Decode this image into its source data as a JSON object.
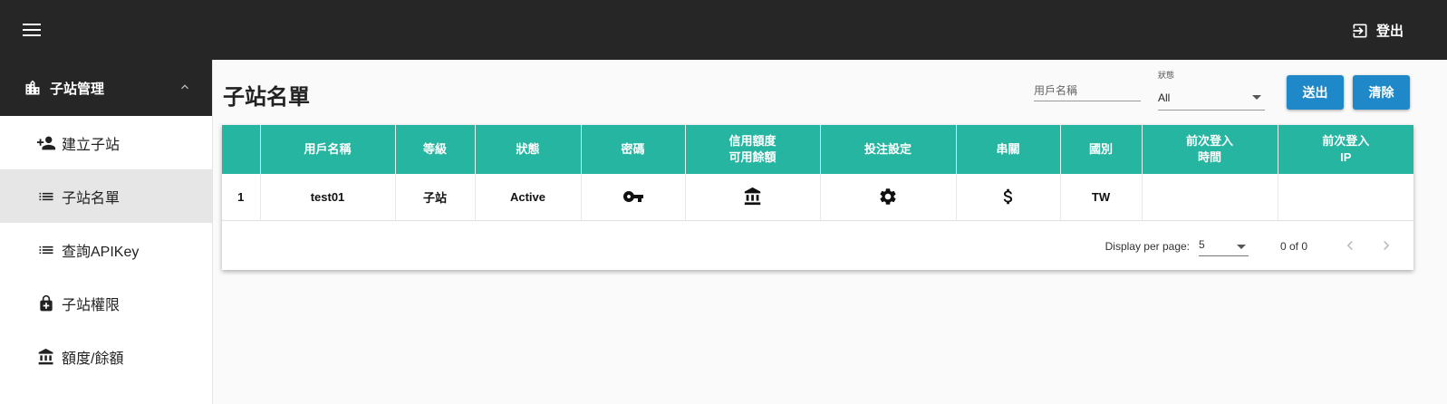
{
  "header": {
    "logout_label": "登出"
  },
  "sidebar": {
    "section_label": "子站管理",
    "items": [
      {
        "label": "建立子站",
        "icon": "person-add-icon"
      },
      {
        "label": "子站名單",
        "icon": "list-icon",
        "active": true
      },
      {
        "label": "查詢APIKey",
        "icon": "list-icon"
      },
      {
        "label": "子站權限",
        "icon": "lock-icon"
      },
      {
        "label": "額度/餘額",
        "icon": "bank-icon"
      }
    ]
  },
  "main": {
    "title": "子站名單",
    "filters": {
      "username_placeholder": "用戶名稱",
      "status_label": "狀態",
      "status_value": "All"
    },
    "submit_label": "送出",
    "clear_label": "清除"
  },
  "table": {
    "headers": [
      "",
      "用戶名稱",
      "等級",
      "狀態",
      "密碼",
      "信用額度\n可用餘額",
      "投注設定",
      "串關",
      "國別",
      "前次登入\n時間",
      "前次登入\nIP"
    ],
    "rows": [
      {
        "index": "1",
        "username": "test01",
        "level": "子站",
        "status": "Active",
        "country": "TW",
        "last_login_time": "",
        "last_login_ip": ""
      }
    ]
  },
  "pagination": {
    "per_page_label": "Display per page:",
    "per_page_value": "5",
    "range_text": "0 of 0"
  },
  "colors": {
    "appbar": "#262626",
    "header_teal": "#26b5a0",
    "button_blue": "#1e88c9"
  }
}
